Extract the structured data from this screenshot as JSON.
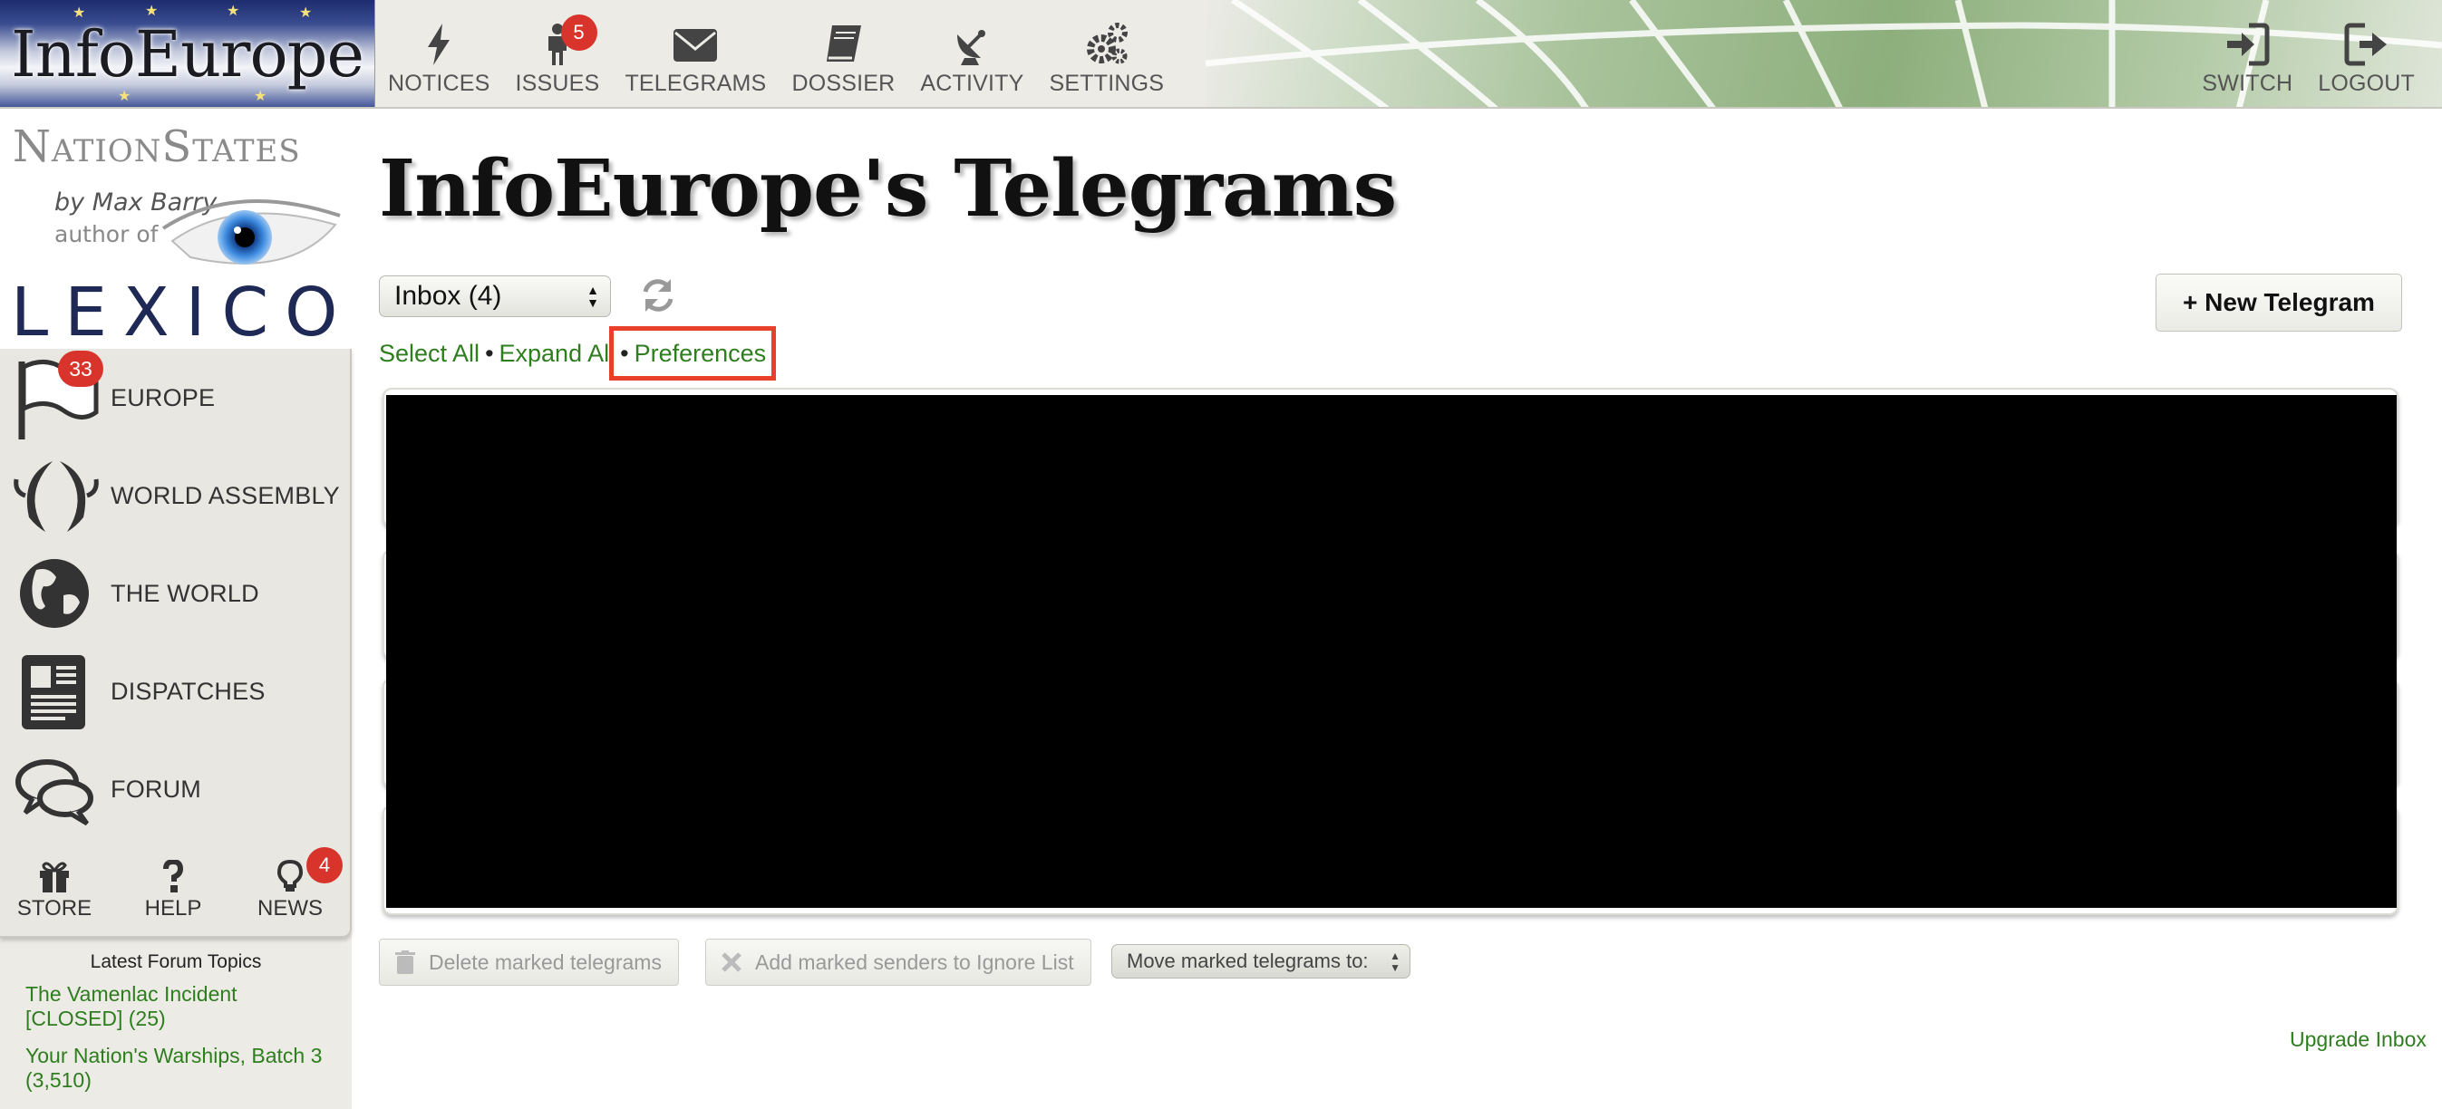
{
  "header": {
    "logo_text": "InfoEurope",
    "nav": [
      {
        "label": "NOTICES",
        "icon": "bolt-icon"
      },
      {
        "label": "ISSUES",
        "icon": "person-icon",
        "badge": "5"
      },
      {
        "label": "TELEGRAMS",
        "icon": "envelope-icon"
      },
      {
        "label": "DOSSIER",
        "icon": "book-icon"
      },
      {
        "label": "ACTIVITY",
        "icon": "satellite-dish-icon"
      },
      {
        "label": "SETTINGS",
        "icon": "gears-icon"
      }
    ],
    "right_nav": [
      {
        "label": "SWITCH",
        "icon": "sign-in-icon"
      },
      {
        "label": "LOGOUT",
        "icon": "sign-out-icon"
      }
    ]
  },
  "sidebar": {
    "brand": {
      "title": "NationStates",
      "byline": "by Max Barry",
      "author_of": "author of",
      "book": "LEXICON"
    },
    "items": [
      {
        "label": "EUROPE",
        "icon": "flag-icon",
        "badge": "33"
      },
      {
        "label": "WORLD ASSEMBLY",
        "icon": "laurel-icon"
      },
      {
        "label": "THE WORLD",
        "icon": "globe-icon"
      },
      {
        "label": "DISPATCHES",
        "icon": "newspaper-icon"
      },
      {
        "label": "FORUM",
        "icon": "speech-bubbles-icon"
      }
    ],
    "mini": [
      {
        "label": "STORE",
        "icon": "gift-icon"
      },
      {
        "label": "HELP",
        "icon": "question-icon"
      },
      {
        "label": "NEWS",
        "icon": "lightbulb-icon",
        "badge": "4"
      }
    ],
    "forum": {
      "heading": "Latest Forum Topics",
      "topics": [
        "The Vamenlac Incident [CLOSED] (25)",
        "Your Nation's Warships, Batch 3 (3,510)"
      ]
    }
  },
  "main": {
    "title": "InfoEurope's Telegrams",
    "folder_select": "Inbox (4)",
    "new_telegram": "+ New Telegram",
    "actions": {
      "select_all": "Select All",
      "expand_all": "Expand All",
      "preferences": "Preferences",
      "separator": "•"
    },
    "bottom": {
      "delete": "Delete marked telegrams",
      "ignore": "Add marked senders to Ignore List",
      "move": "Move marked telegrams to:"
    },
    "upgrade": "Upgrade Inbox"
  },
  "colors": {
    "link_green": "#2e7d1e",
    "badge_red": "#d9342b",
    "highlight": "#e8402a",
    "chrome_gray": "#ecebe6"
  }
}
